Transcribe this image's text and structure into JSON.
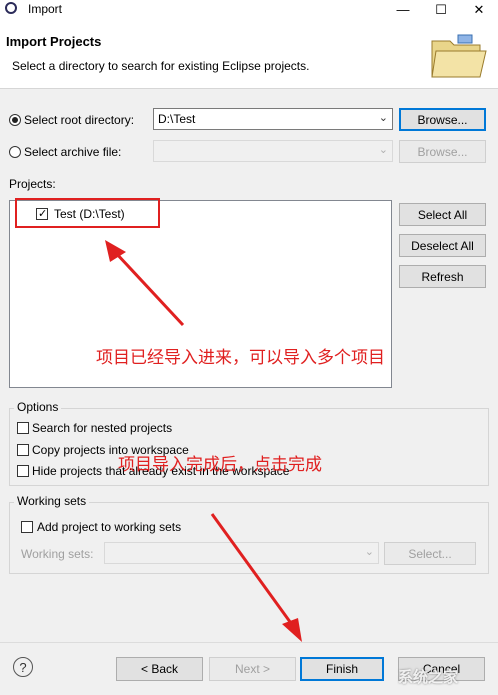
{
  "window": {
    "title": "Import",
    "controls": [
      "—",
      "☐",
      "✕"
    ]
  },
  "header": {
    "title": "Import Projects",
    "description": "Select a directory to search for existing Eclipse projects."
  },
  "source": {
    "root_label": "Select root directory:",
    "root_value": "D:\\Test",
    "archive_label": "Select archive file:",
    "archive_value": "",
    "browse_label": "Browse...",
    "browse_archive_label": "Browse..."
  },
  "projects": {
    "label": "Projects:",
    "items": [
      {
        "label": "Test (D:\\Test)",
        "checked": true
      }
    ],
    "select_all": "Select All",
    "deselect_all": "Deselect All",
    "refresh": "Refresh"
  },
  "options": {
    "label": "Options",
    "search_nested": "Search for nested projects",
    "copy_projects": "Copy projects into workspace",
    "hide_projects": "Hide projects that already exist in the workspace"
  },
  "working_sets": {
    "label": "Working sets",
    "add_to_sets": "Add project to working sets",
    "sets_label": "Working sets:",
    "select_label": "Select..."
  },
  "footer": {
    "help": "?",
    "back": "< Back",
    "next": "Next >",
    "finish": "Finish",
    "cancel": "Cancel"
  },
  "annotations": {
    "note1": "项目已经导入进来，可以导入多个项目",
    "note2": "项目导入完成后，点击完成",
    "watermark": "系统之家"
  },
  "colors": {
    "annotation": "#e02020",
    "focus": "#0078d7"
  }
}
